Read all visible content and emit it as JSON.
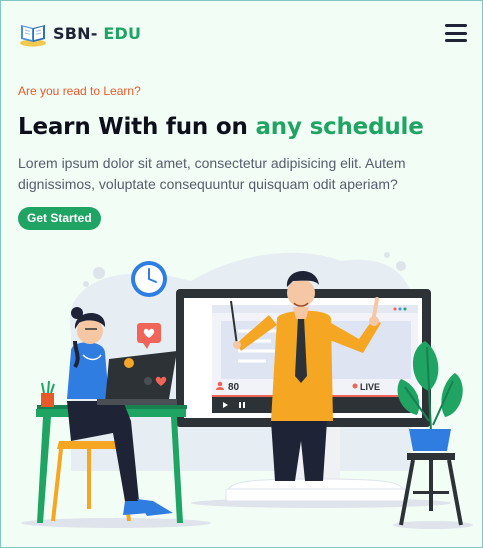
{
  "brand": {
    "name": "SBN-",
    "accent": "EDU"
  },
  "colors": {
    "brand": "#1fa463",
    "kicker": "#e8592a",
    "text": "#0d0f1a",
    "background": "#f2fdf5"
  },
  "header": {
    "menu_icon": "hamburger-menu-icon"
  },
  "hero": {
    "kicker": "Are you read to Learn?",
    "headline_plain": "Learn With fun on ",
    "headline_highlight": "any schedule",
    "description": "Lorem ipsum dolor sit amet, consectetur adipisicing elit. Autem dignissimos, voluptate consequuntur quisquam odit aperiam?",
    "cta_label": "Get Started"
  },
  "video_player": {
    "viewers": "80",
    "live_label": "LIVE"
  }
}
